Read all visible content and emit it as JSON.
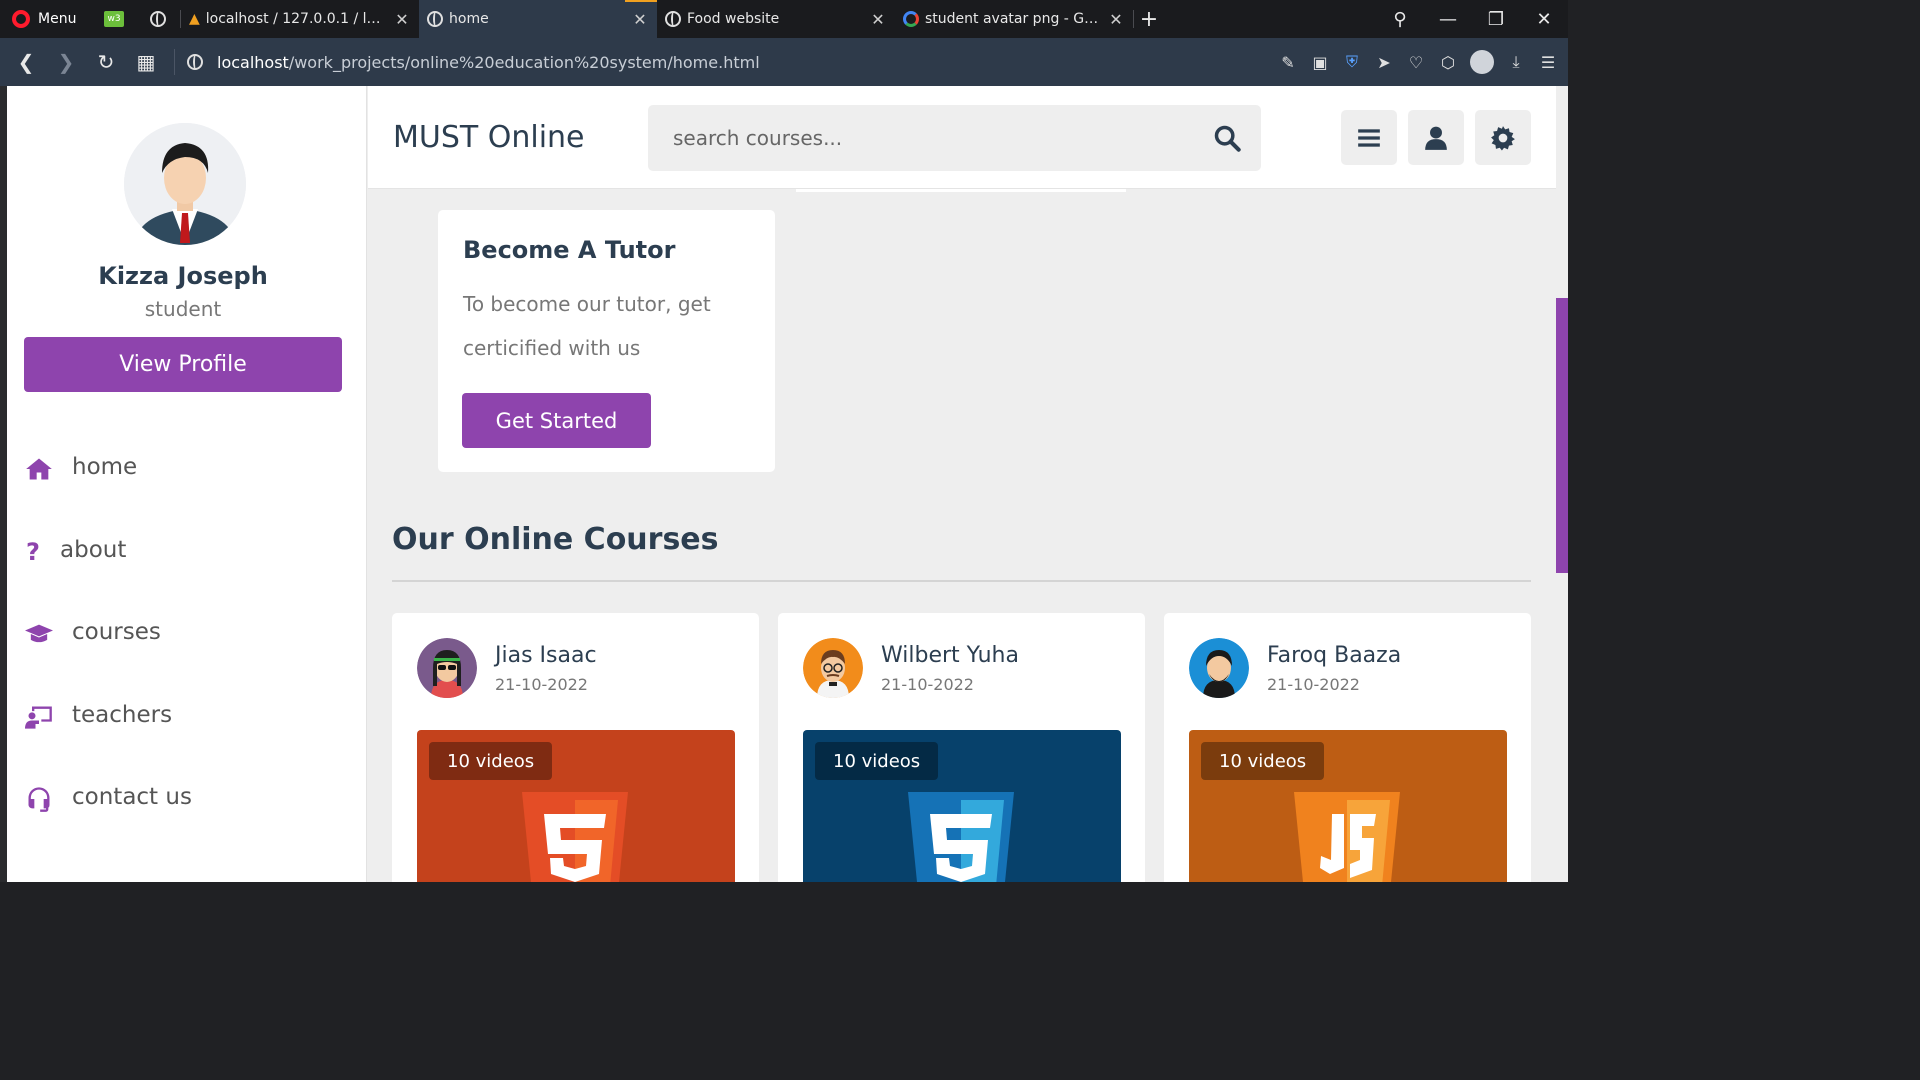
{
  "browser": {
    "menu_label": "Menu",
    "pinned": [
      {
        "label": "w3"
      },
      {
        "label": ""
      }
    ],
    "tabs": [
      {
        "title": "localhost / 127.0.0.1 / lemer",
        "icon": "phpmyadmin-icon",
        "active": false
      },
      {
        "title": "home",
        "icon": "globe-icon",
        "active": true
      },
      {
        "title": "Food website",
        "icon": "globe-icon",
        "active": false
      },
      {
        "title": "student avatar png - Google",
        "icon": "google-icon",
        "active": false
      }
    ],
    "new_tab": "+",
    "address": {
      "host": "localhost",
      "path": "/work_projects/online%20education%20system/home.html"
    }
  },
  "sidebar": {
    "profile": {
      "name": "Kizza Joseph",
      "role": "student",
      "button": "View Profile"
    },
    "nav": [
      {
        "label": "home",
        "icon": "home-icon"
      },
      {
        "label": "about",
        "icon": "question-icon"
      },
      {
        "label": "courses",
        "icon": "graduation-cap-icon"
      },
      {
        "label": "teachers",
        "icon": "chalkboard-teacher-icon"
      },
      {
        "label": "contact us",
        "icon": "headset-icon"
      }
    ]
  },
  "header": {
    "brand": "MUST Online",
    "search_placeholder": "search courses...",
    "buttons": [
      "menu-icon",
      "user-icon",
      "settings-icon"
    ]
  },
  "tutor_box": {
    "title": "Become A Tutor",
    "text": "To become our tutor, get certicified with us",
    "button": "Get Started"
  },
  "courses": {
    "title": "Our Online Courses",
    "items": [
      {
        "tutor": "Jias Isaac",
        "date": "21-10-2022",
        "badge": "10 videos",
        "logo": "html5-icon",
        "color": "#c4421c"
      },
      {
        "tutor": "Wilbert Yuha",
        "date": "21-10-2022",
        "badge": "10 videos",
        "logo": "css3-icon",
        "color": "#07416b"
      },
      {
        "tutor": "Faroq Baaza",
        "date": "21-10-2022",
        "badge": "10 videos",
        "logo": "js-icon",
        "color": "#bd5d14"
      }
    ]
  },
  "colors": {
    "accent": "#8e44ad",
    "heading": "#2c3e50",
    "muted": "#777777",
    "page_bg": "#eeeeee"
  }
}
